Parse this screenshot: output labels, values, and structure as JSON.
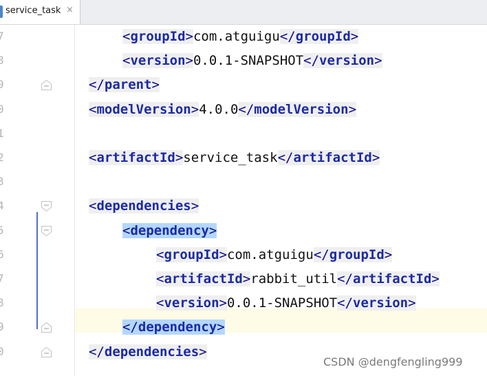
{
  "tab": {
    "title": "service_task",
    "close": "×"
  },
  "gutter": {
    "line_numbers": [
      "7",
      "8",
      "9",
      "0",
      "1",
      "2",
      "3",
      "4",
      "5",
      "6",
      "7",
      "8",
      "9",
      "0"
    ]
  },
  "code": [
    {
      "indent": 2,
      "type": "elem",
      "tag": "groupId",
      "value": "com.atguigu"
    },
    {
      "indent": 2,
      "type": "elem",
      "tag": "version",
      "value": "0.0.1-SNAPSHOT"
    },
    {
      "indent": 1,
      "type": "close",
      "tag": "parent"
    },
    {
      "indent": 1,
      "type": "elem",
      "tag": "modelVersion",
      "value": "4.0.0"
    },
    {
      "indent": 1,
      "type": "blank"
    },
    {
      "indent": 1,
      "type": "elem",
      "tag": "artifactId",
      "value": "service_task"
    },
    {
      "indent": 1,
      "type": "blank"
    },
    {
      "indent": 1,
      "type": "open",
      "tag": "dependencies"
    },
    {
      "indent": 2,
      "type": "open",
      "tag": "dependency",
      "selected": true
    },
    {
      "indent": 3,
      "type": "elem",
      "tag": "groupId",
      "value": "com.atguigu"
    },
    {
      "indent": 3,
      "type": "elem",
      "tag": "artifactId",
      "value": "rabbit_util"
    },
    {
      "indent": 3,
      "type": "elem",
      "tag": "version",
      "value": "0.0.1-SNAPSHOT"
    },
    {
      "indent": 2,
      "type": "close",
      "tag": "dependency",
      "selected": true,
      "current": true
    },
    {
      "indent": 1,
      "type": "close",
      "tag": "dependencies"
    }
  ],
  "watermark": "CSDN @dengfengling999",
  "colors": {
    "tag": "#1c2aa4",
    "selection": "#b3d7ff",
    "current_line": "#fefbe6"
  }
}
